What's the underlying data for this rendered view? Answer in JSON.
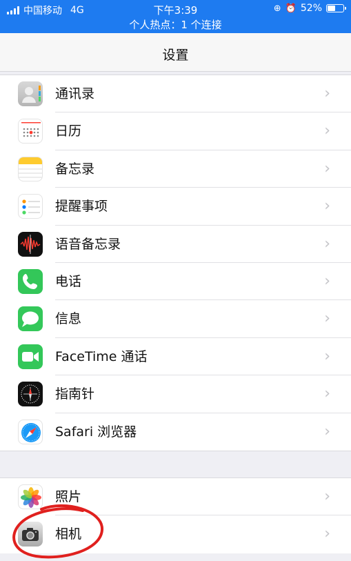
{
  "status_bar": {
    "carrier": "中国移动",
    "network": "4G",
    "time": "下午3:39",
    "battery_percent": "52%",
    "battery_level": 0.52,
    "hotspot_text": "个人热点：1 个连接",
    "bg_color": "#1e7bf0"
  },
  "navbar": {
    "title": "设置"
  },
  "group1": [
    {
      "label": "通讯录",
      "icon": "contacts-icon"
    },
    {
      "label": "日历",
      "icon": "calendar-icon"
    },
    {
      "label": "备忘录",
      "icon": "notes-icon"
    },
    {
      "label": "提醒事项",
      "icon": "reminders-icon"
    },
    {
      "label": "语音备忘录",
      "icon": "voice-memos-icon"
    },
    {
      "label": "电话",
      "icon": "phone-icon"
    },
    {
      "label": "信息",
      "icon": "messages-icon"
    },
    {
      "label": "FaceTime 通话",
      "icon": "facetime-icon"
    },
    {
      "label": "指南针",
      "icon": "compass-icon"
    },
    {
      "label": "Safari 浏览器",
      "icon": "safari-icon"
    }
  ],
  "group2": [
    {
      "label": "照片",
      "icon": "photos-icon"
    },
    {
      "label": "相机",
      "icon": "camera-icon"
    }
  ],
  "chevron": "›",
  "annotation_color": "#e0201e"
}
